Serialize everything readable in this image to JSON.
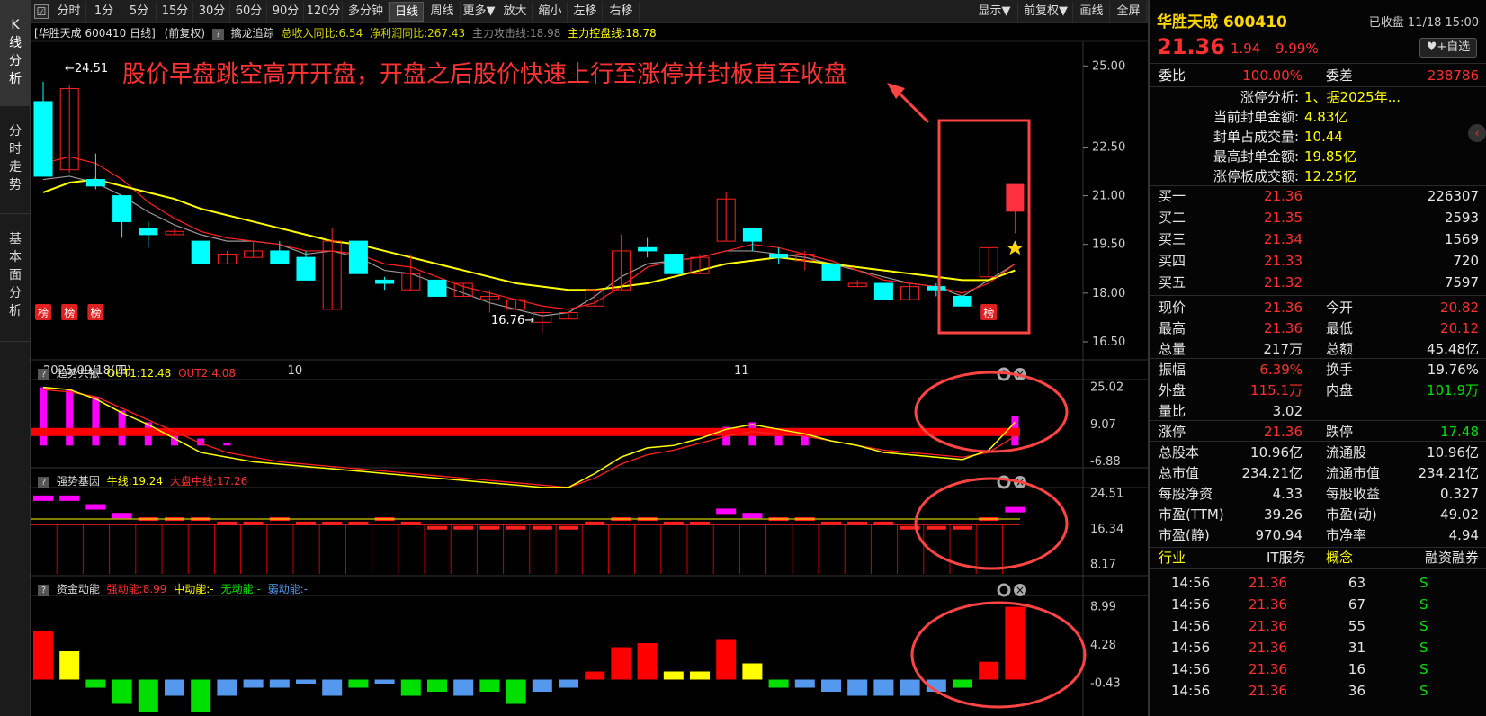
{
  "left_tabs": [
    {
      "label": "K线分析"
    },
    {
      "label": "分时走势"
    },
    {
      "label": "基本面分析"
    }
  ],
  "toolbar": {
    "periods": [
      "分时",
      "1分",
      "5分",
      "15分",
      "30分",
      "60分",
      "90分",
      "120分",
      "多分钟",
      "日线",
      "周线",
      "更多▼",
      "放大",
      "缩小",
      "左移",
      "右移"
    ],
    "active": "日线",
    "right": [
      "显示▼",
      "前复权▼",
      "画线",
      "全屏"
    ]
  },
  "main_header": {
    "title": "[华胜天成 600410 日线]",
    "adj": "(前复权)",
    "indicator": "擒龙追踪",
    "i1": "总收入同比:6.54",
    "i2": "净利润同比:267.43",
    "i3": "主力攻击线:18.98",
    "i4": "主力控盘线:18.78"
  },
  "annotation": {
    "text": "股价早盘跳空高开开盘，开盘之后股价快速上行至涨停并封板直至收盘",
    "color": "#ff3333"
  },
  "price_axis": [
    "25.00",
    "22.50",
    "21.00",
    "19.50",
    "18.00",
    "16.50"
  ],
  "dates": [
    "2025/09/18(四)",
    "10",
    "11"
  ],
  "price_labels": {
    "high": "24.51",
    "low": "16.76"
  },
  "bang_label": "榜",
  "chart_data": {
    "type": "candlestick",
    "ylim": [
      16.0,
      25.7
    ],
    "candles": [
      [
        23.9,
        21.6,
        24.51,
        21.6
      ],
      [
        21.8,
        24.3,
        24.4,
        21.7
      ],
      [
        21.5,
        21.3,
        22.3,
        21.2
      ],
      [
        21.0,
        20.2,
        21.0,
        19.7
      ],
      [
        20.0,
        19.8,
        20.2,
        19.4
      ],
      [
        19.8,
        19.9,
        20.0,
        19.8
      ],
      [
        19.6,
        18.9,
        19.6,
        18.9
      ],
      [
        18.9,
        19.2,
        19.3,
        18.9
      ],
      [
        19.1,
        19.3,
        19.6,
        19.1
      ],
      [
        19.3,
        18.9,
        19.6,
        18.9
      ],
      [
        19.1,
        18.4,
        19.3,
        18.4
      ],
      [
        17.5,
        19.6,
        20.0,
        17.5
      ],
      [
        19.6,
        18.6,
        19.6,
        18.6
      ],
      [
        18.4,
        18.3,
        18.5,
        18.1
      ],
      [
        18.1,
        18.6,
        19.2,
        18.1
      ],
      [
        18.4,
        17.9,
        18.4,
        17.9
      ],
      [
        17.9,
        18.3,
        18.3,
        17.9
      ],
      [
        17.8,
        17.9,
        18.1,
        17.4
      ],
      [
        17.5,
        17.8,
        17.8,
        17.5
      ],
      [
        17.1,
        17.4,
        17.5,
        16.76
      ],
      [
        17.2,
        17.4,
        17.4,
        17.2
      ],
      [
        17.6,
        18.1,
        18.1,
        17.6
      ],
      [
        18.1,
        19.3,
        19.8,
        18.1
      ],
      [
        19.4,
        19.3,
        19.7,
        19.1
      ],
      [
        19.2,
        18.6,
        19.2,
        18.6
      ],
      [
        18.6,
        19.1,
        19.2,
        18.6
      ],
      [
        19.6,
        20.9,
        21.1,
        19.6
      ],
      [
        20.0,
        19.6,
        20.0,
        19.3
      ],
      [
        19.2,
        19.1,
        19.4,
        18.9
      ],
      [
        19.0,
        19.2,
        19.3,
        18.7
      ],
      [
        18.9,
        18.4,
        18.9,
        18.4
      ],
      [
        18.2,
        18.3,
        18.4,
        18.2
      ],
      [
        18.3,
        17.8,
        18.3,
        17.8
      ],
      [
        17.8,
        18.2,
        18.3,
        17.8
      ],
      [
        18.2,
        18.1,
        18.3,
        17.9
      ],
      [
        17.9,
        17.6,
        17.9,
        17.6
      ],
      [
        18.5,
        19.4,
        19.4,
        18.5
      ],
      [
        20.82,
        21.36,
        21.36,
        20.12
      ]
    ],
    "ma_yellow": [
      21.1,
      21.4,
      21.5,
      21.3,
      21.1,
      20.9,
      20.6,
      20.4,
      20.2,
      20.0,
      19.8,
      19.6,
      19.5,
      19.3,
      19.1,
      18.9,
      18.7,
      18.5,
      18.3,
      18.2,
      18.1,
      18.1,
      18.2,
      18.3,
      18.5,
      18.7,
      18.9,
      19.0,
      19.1,
      19.0,
      18.9,
      18.8,
      18.7,
      18.6,
      18.5,
      18.4,
      18.4,
      18.7
    ],
    "ma_red": [
      22.0,
      22.2,
      22.0,
      21.5,
      20.8,
      20.3,
      19.9,
      19.7,
      19.6,
      19.5,
      19.3,
      19.3,
      19.2,
      18.9,
      18.8,
      18.5,
      18.2,
      18.0,
      17.8,
      17.6,
      17.5,
      17.7,
      18.2,
      18.8,
      19.0,
      19.1,
      19.3,
      19.5,
      19.4,
      19.2,
      19.0,
      18.7,
      18.4,
      18.3,
      18.2,
      18.0,
      18.3,
      18.9
    ],
    "ma_gray": [
      21.5,
      21.6,
      21.4,
      21.0,
      20.5,
      20.1,
      19.8,
      19.6,
      19.6,
      19.5,
      19.2,
      19.3,
      19.1,
      18.7,
      18.6,
      18.3,
      18.0,
      17.7,
      17.5,
      17.3,
      17.4,
      17.9,
      18.5,
      18.9,
      19.0,
      19.1,
      19.3,
      19.3,
      19.2,
      19.1,
      18.9,
      18.7,
      18.5,
      18.3,
      18.2,
      17.9,
      18.4,
      18.9
    ]
  },
  "sub1": {
    "title": "趋势共振",
    "out1": "OUT1:12.48",
    "out2": "OUT2:4.08",
    "axis": [
      "25.02",
      "9.07",
      "-6.88"
    ],
    "bars": [
      25,
      24,
      21,
      15,
      10,
      6,
      3,
      1,
      0,
      0,
      0,
      0,
      0,
      0,
      0,
      0,
      0,
      0,
      0,
      0,
      0,
      0,
      0,
      0,
      0,
      0,
      8,
      10,
      7,
      6,
      0,
      0,
      0,
      0,
      0,
      0,
      0,
      12.48
    ],
    "line1": [
      25,
      24,
      20,
      14,
      9,
      3,
      -3,
      -5,
      -7,
      -8,
      -9,
      -10,
      -11,
      -12,
      -13,
      -14,
      -15,
      -16,
      -17,
      -18,
      -18,
      -12,
      -5,
      -1,
      0,
      3,
      7,
      9,
      7,
      5,
      2,
      0,
      -3,
      -4,
      -5,
      -6,
      -2,
      10
    ],
    "line2": [
      24,
      23,
      21,
      16,
      11,
      6,
      1,
      -3,
      -5,
      -7,
      -8,
      -9,
      -10,
      -11,
      -12,
      -13,
      -14,
      -15,
      -16,
      -17,
      -18,
      -14,
      -8,
      -4,
      -2,
      1,
      4,
      6,
      5,
      4,
      2,
      0,
      -2,
      -3,
      -4,
      -5,
      -3,
      4
    ]
  },
  "sub2": {
    "title": "强势基因",
    "l1": "牛线:19.24",
    "l2": "大盘中线:17.26",
    "axis": [
      "24.51",
      "16.34",
      "8.17"
    ],
    "bars": [
      24,
      24,
      22,
      20,
      19,
      19,
      19,
      18,
      18,
      19,
      18,
      18,
      18,
      19,
      18,
      17,
      17,
      17,
      17,
      17,
      17,
      18,
      19,
      19,
      18,
      18,
      21,
      20,
      19,
      19,
      18,
      18,
      18,
      17,
      17,
      17,
      19,
      21.36
    ]
  },
  "sub3": {
    "title": "资金动能",
    "s1": "强动能:8.99",
    "s2": "中动能:-",
    "s3": "无动能:-",
    "s4": "弱动能:-",
    "axis": [
      "8.99",
      "4.28",
      "-0.43"
    ],
    "bars": [
      6,
      3.5,
      -1,
      -3,
      -4,
      -2,
      -4,
      -2,
      -1,
      -1,
      -0.5,
      -2,
      -1,
      -0.5,
      -2,
      -1.5,
      -2,
      -1.5,
      -3,
      -1.5,
      -1,
      1,
      4,
      4.5,
      1,
      1,
      5,
      2,
      -1,
      -1,
      -1.5,
      -2,
      -2,
      -2,
      -1.5,
      -1,
      2.2,
      8.99
    ],
    "colors": [
      "#ff0000",
      "#ffff00",
      "#00e000",
      "#00e000",
      "#00e000",
      "#5599ee",
      "#00e000",
      "#5599ee",
      "#5599ee",
      "#5599ee",
      "#5599ee",
      "#5599ee",
      "#00e000",
      "#5599ee",
      "#00e000",
      "#00e000",
      "#5599ee",
      "#00e000",
      "#00e000",
      "#5599ee",
      "#5599ee",
      "#ff0000",
      "#ff0000",
      "#ff0000",
      "#ffff00",
      "#ffff00",
      "#ff0000",
      "#ffff00",
      "#00e000",
      "#5599ee",
      "#5599ee",
      "#5599ee",
      "#5599ee",
      "#5599ee",
      "#5599ee",
      "#00e000",
      "#ff0000",
      "#ff0000"
    ]
  },
  "quote": {
    "name": "华胜天成 600410",
    "status": "已收盘 11/18 15:00",
    "price": "21.36",
    "change": "1.94",
    "pct": "9.99%",
    "fav": "+自选",
    "weibi_l": "委比",
    "weibi": "100.00%",
    "weicha_l": "委差",
    "weicha": "238786",
    "zt_lines": [
      {
        "k": "涨停分析:",
        "v": "1、据2025年..."
      },
      {
        "k": "当前封单金额:",
        "v": "4.83亿"
      },
      {
        "k": "封单占成交量:",
        "v": "10.44"
      },
      {
        "k": "最高封单金额:",
        "v": "19.85亿"
      },
      {
        "k": "涨停板成交额:",
        "v": "12.25亿"
      }
    ],
    "buys": [
      {
        "l": "买一",
        "p": "21.36",
        "v": "226307"
      },
      {
        "l": "买二",
        "p": "21.35",
        "v": "2593"
      },
      {
        "l": "买三",
        "p": "21.34",
        "v": "1569"
      },
      {
        "l": "买四",
        "p": "21.33",
        "v": "720"
      },
      {
        "l": "买五",
        "p": "21.32",
        "v": "7597"
      }
    ],
    "stats": [
      {
        "l1": "现价",
        "v1": "21.36",
        "c1": "red",
        "l2": "今开",
        "v2": "20.82",
        "c2": "red"
      },
      {
        "l1": "最高",
        "v1": "21.36",
        "c1": "red",
        "l2": "最低",
        "v2": "20.12",
        "c2": "red"
      },
      {
        "l1": "总量",
        "v1": "217万",
        "c1": "white",
        "l2": "总额",
        "v2": "45.48亿",
        "c2": "white"
      },
      {
        "l1": "振幅",
        "v1": "6.39%",
        "c1": "red",
        "l2": "换手",
        "v2": "19.76%",
        "c2": "white"
      },
      {
        "l1": "外盘",
        "v1": "115.1万",
        "c1": "red",
        "l2": "内盘",
        "v2": "101.9万",
        "c2": "green"
      },
      {
        "l1": "量比",
        "v1": "3.02",
        "c1": "white",
        "l2": "",
        "v2": "",
        "c2": "white"
      },
      {
        "l1": "涨停",
        "v1": "21.36",
        "c1": "red",
        "l2": "跌停",
        "v2": "17.48",
        "c2": "green"
      },
      {
        "l1": "总股本",
        "v1": "10.96亿",
        "c1": "white",
        "l2": "流通股",
        "v2": "10.96亿",
        "c2": "white"
      },
      {
        "l1": "总市值",
        "v1": "234.21亿",
        "c1": "white",
        "l2": "流通市值",
        "v2": "234.21亿",
        "c2": "white"
      },
      {
        "l1": "每股净资",
        "v1": "4.33",
        "c1": "white",
        "l2": "每股收益",
        "v2": "0.327",
        "c2": "white"
      },
      {
        "l1": "市盈(TTM)",
        "v1": "39.26",
        "c1": "white",
        "l2": "市盈(动)",
        "v2": "49.02",
        "c2": "white"
      },
      {
        "l1": "市盈(静)",
        "v1": "970.94",
        "c1": "white",
        "l2": "市净率",
        "v2": "4.94",
        "c2": "white"
      }
    ],
    "tabs": [
      "行业",
      "IT服务",
      "概念",
      "融资融券"
    ],
    "ticks": [
      {
        "t": "14:56",
        "p": "21.36",
        "v": "63",
        "s": "S"
      },
      {
        "t": "14:56",
        "p": "21.36",
        "v": "67",
        "s": "S"
      },
      {
        "t": "14:56",
        "p": "21.36",
        "v": "55",
        "s": "S"
      },
      {
        "t": "14:56",
        "p": "21.36",
        "v": "31",
        "s": "S"
      },
      {
        "t": "14:56",
        "p": "21.36",
        "v": "16",
        "s": "S"
      },
      {
        "t": "14:56",
        "p": "21.36",
        "v": "36",
        "s": "S"
      }
    ]
  }
}
